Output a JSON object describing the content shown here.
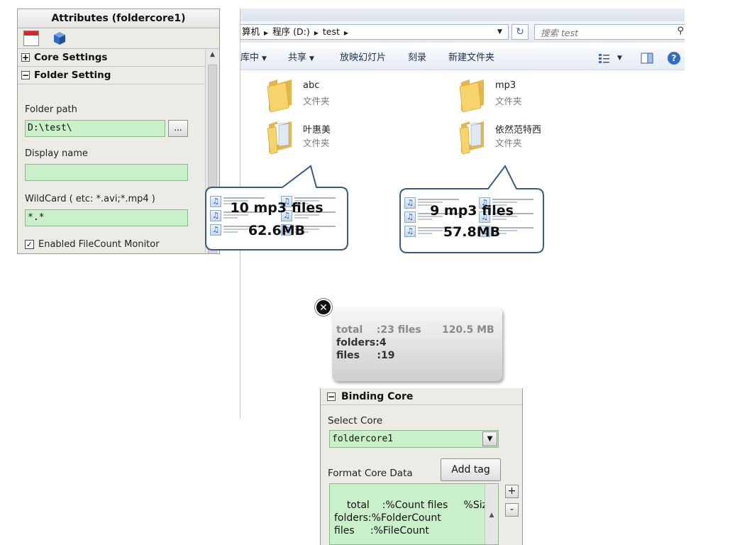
{
  "attributes": {
    "title": "Attributes (foldercore1)",
    "sections": {
      "core_settings": "Core Settings",
      "folder_setting": "Folder Setting"
    },
    "folder_path_label": "Folder path",
    "folder_path_value": "D:\\test\\",
    "browse_button": "...",
    "display_name_label": "Display name",
    "display_name_value": "",
    "wildcard_label": "WildCard ( etc: *.avi;*.mp4 )",
    "wildcard_value": "*.*",
    "filecount_monitor_label": "Enabled FileCount Monitor",
    "filecount_monitor_checked": true
  },
  "explorer": {
    "breadcrumb": [
      "算机",
      "程序 (D:)",
      "test"
    ],
    "search_placeholder": "搜索 test",
    "commands": [
      "库中",
      "共享",
      "放映幻灯片",
      "刻录",
      "新建文件夹"
    ],
    "folders": [
      {
        "name": "abc",
        "type": "文件夹"
      },
      {
        "name": "mp3",
        "type": "文件夹"
      },
      {
        "name": "叶惠美",
        "type": "文件夹"
      },
      {
        "name": "依然范特西",
        "type": "文件夹"
      }
    ]
  },
  "callouts": [
    {
      "line1": "10 mp3 files",
      "line2": "62.6MB"
    },
    {
      "line1": "9 mp3 files",
      "line2": "57.8MB"
    }
  ],
  "summary": {
    "line1": "total    :23 files      120.5 MB",
    "line2": "folders:4",
    "line3": "files     :19"
  },
  "binding": {
    "header": "Binding Core",
    "select_core_label": "Select Core",
    "selected_core": "foldercore1",
    "format_label": "Format Core Data",
    "add_tag_button": "Add tag",
    "format_text": "total    :%Count files     %Size\nfolders:%FolderCount\nfiles     :%FileCount",
    "plus_button": "+",
    "minus_button": "-"
  },
  "colors": {
    "input_green": "#c9f0c9",
    "help_blue": "#2f6ec7",
    "folder_yellow": "#f4cf62",
    "callout_border": "#3d5a80"
  }
}
